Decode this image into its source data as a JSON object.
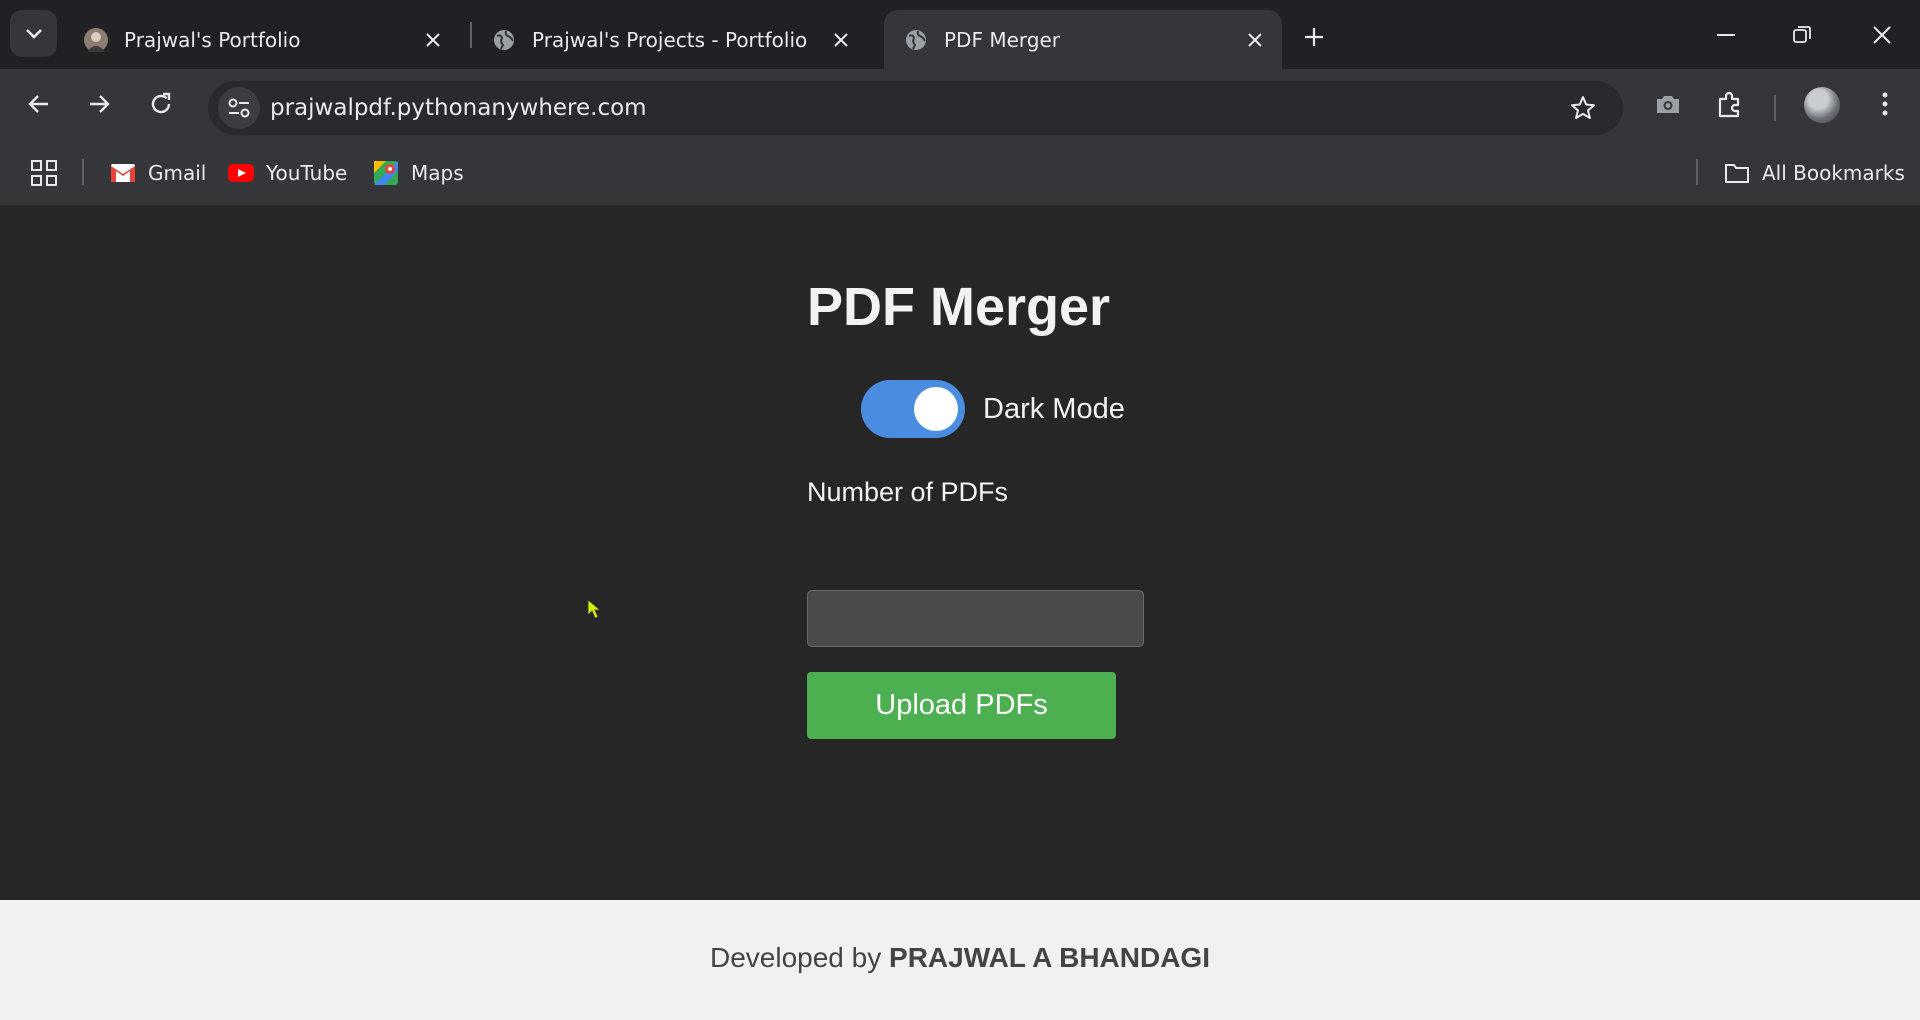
{
  "browser": {
    "tabs": [
      {
        "title": "Prajwal's Portfolio",
        "active": false
      },
      {
        "title": "Prajwal's Projects - Portfolio",
        "active": false
      },
      {
        "title": "PDF Merger",
        "active": true
      }
    ],
    "url": "prajwalpdf.pythonanywhere.com",
    "bookmarks": [
      {
        "label": "Gmail",
        "icon": "gmail-icon"
      },
      {
        "label": "YouTube",
        "icon": "youtube-icon"
      },
      {
        "label": "Maps",
        "icon": "maps-icon"
      }
    ],
    "all_bookmarks_label": "All Bookmarks"
  },
  "page": {
    "title": "PDF Merger",
    "dark_mode": {
      "label": "Dark Mode",
      "enabled": true
    },
    "num_pdfs": {
      "label": "Number of PDFs",
      "value": ""
    },
    "upload_button": "Upload PDFs"
  },
  "footer": {
    "prefix": "Developed by",
    "name": "PRAJWAL A BHANDAGI"
  },
  "colors": {
    "page_bg": "#262626",
    "toggle_on": "#4a8de0",
    "button_green": "#4caf50",
    "footer_bg": "#f1f1f1"
  }
}
